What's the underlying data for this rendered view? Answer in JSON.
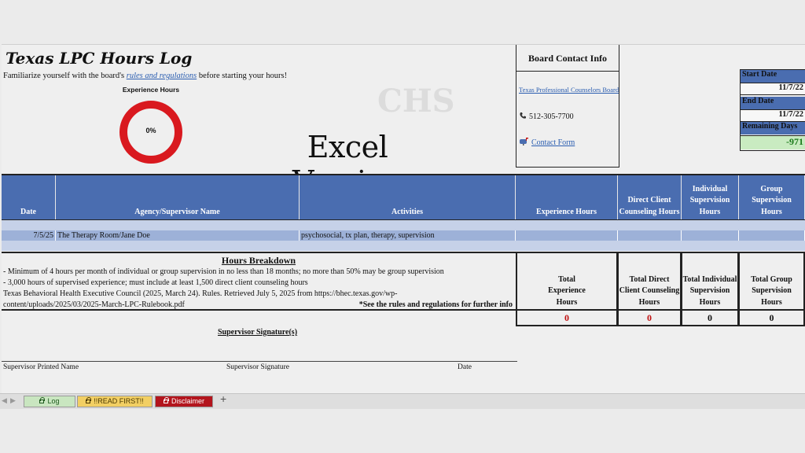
{
  "header": {
    "title": "Texas LPC Hours Log",
    "intro_before": "Familiarize yourself with the board's ",
    "intro_link": "rules and regulations",
    "intro_after": " before starting your hours!",
    "experience_label": "Experience Hours",
    "experience_percent": "0%",
    "experience_fraction": 0,
    "watermark": "CHS",
    "banner": "Excel Version"
  },
  "contact": {
    "heading": "Board Contact Info",
    "board_link": "Texas Professional Counselors Board",
    "phone": "512-305-7700",
    "form_link": "Contact Form"
  },
  "dates": {
    "start_label": "Start Date",
    "start_value": "11/7/22",
    "end_label": "End Date",
    "end_value": "11/7/22",
    "remaining_label": "Remaining Days",
    "remaining_value": "-971"
  },
  "log_table": {
    "columns": [
      "Date",
      "Agency/Supervisor Name",
      "Activities",
      "Experience Hours",
      "Direct Client Counseling Hours",
      "Individual Supervision Hours",
      "Group Supervision Hours"
    ],
    "rows": [
      {
        "date": "7/5/25",
        "agency": "The Therapy Room/Jane Doe",
        "activities": "psychosocial, tx plan, therapy, supervision",
        "experience": "",
        "direct": "",
        "individual": "",
        "group": ""
      }
    ]
  },
  "breakdown": {
    "title": "Hours Breakdown",
    "lines": [
      "- Minimum of 4 hours per month of individual or group supervision in no less than 18 months; no more than 50% may be group supervision",
      "- 3,000 hours of supervised experience; must include at least 1,500 direct client counseling hours",
      "Texas Behavioral Health Executive Council (2025, March 24). Rules. Retrieved July 5, 2025 from https://bhec.texas.gov/wp-",
      "content/uploads/2025/03/2025-March-LPC-Rulebook.pdf"
    ],
    "note": "*See the rules and regulations for further info"
  },
  "totals": {
    "labels": [
      "Total Experience Hours",
      "Total Direct Client Counseling Hours",
      "Total Individual Supervision Hours",
      "Total Group Supervision Hours"
    ],
    "values": [
      "0",
      "0",
      "0",
      "0"
    ]
  },
  "signature": {
    "title": "Supervisor Signature(s)",
    "printed_name": "Supervisor Printed Name",
    "signature": "Supervisor Signature",
    "date": "Date"
  },
  "tabs": {
    "log": "Log",
    "read_first": "!!READ FIRST!!",
    "disclaimer": "Disclaimer",
    "add": "+"
  },
  "colors": {
    "header_blue": "#4a6db0",
    "ring_red": "#d9191f",
    "remaining_green": "#1a7a1a"
  }
}
